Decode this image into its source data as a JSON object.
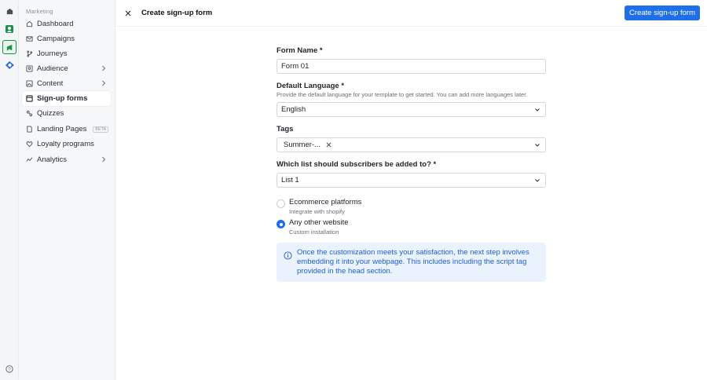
{
  "sidebar": {
    "section_title": "Marketing",
    "items": [
      {
        "label": "Dashboard",
        "icon": "home-icon"
      },
      {
        "label": "Campaigns",
        "icon": "envelope-icon"
      },
      {
        "label": "Journeys",
        "icon": "branch-icon"
      },
      {
        "label": "Audience",
        "icon": "users-icon",
        "chevron": true
      },
      {
        "label": "Content",
        "icon": "image-icon",
        "chevron": true
      },
      {
        "label": "Sign-up forms",
        "icon": "form-icon",
        "active": true
      },
      {
        "label": "Quizzes",
        "icon": "quiz-icon"
      },
      {
        "label": "Landing Pages",
        "icon": "page-icon",
        "badge": "BETA"
      },
      {
        "label": "Loyalty programs",
        "icon": "heart-icon"
      },
      {
        "label": "Analytics",
        "icon": "chart-icon",
        "chevron": true
      }
    ]
  },
  "topbar": {
    "title": "Create sign-up form",
    "primary_button": "Create sign-up form"
  },
  "form": {
    "name_label": "Form Name",
    "name_value": "Form 01",
    "language_label": "Default Language",
    "language_helper": "Provide the default language for your template to get started. You can add more languages later.",
    "language_value": "English",
    "tags_label": "Tags",
    "tag_value": "Summer-...",
    "list_label": "Which list should subscribers be added to?",
    "list_value": "List 1",
    "required_mark": "*",
    "platform_options": [
      {
        "title": "Ecommerce platforms",
        "subtitle": "Integrate with shopify",
        "selected": false
      },
      {
        "title": "Any other website",
        "subtitle": "Custom installation",
        "selected": true
      }
    ],
    "info_text": "Once the customization meets your satisfaction, the next step involves embedding it into your webpage. This includes including the script tag provided in the head section."
  },
  "colors": {
    "accent": "#1f6fe8",
    "info_bg": "#eaf2fd",
    "info_text": "#1f5fd6"
  }
}
